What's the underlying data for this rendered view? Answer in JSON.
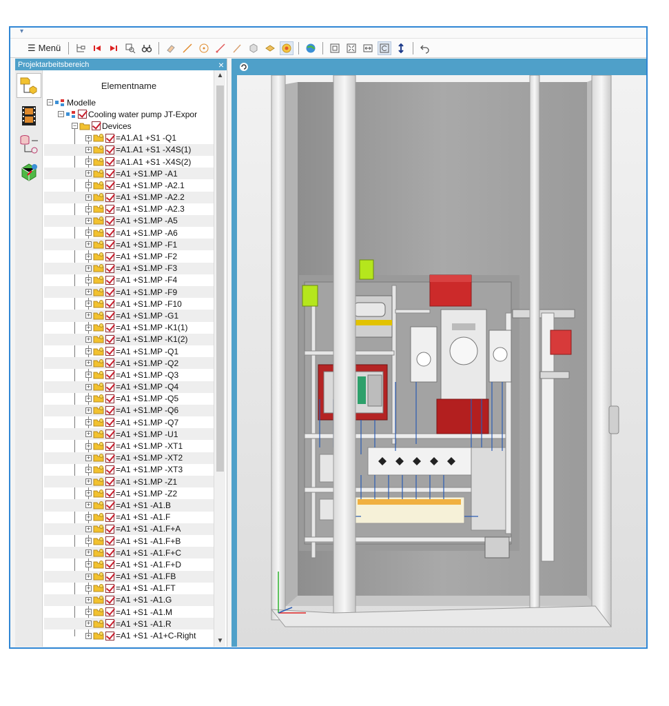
{
  "toolbar": {
    "menu_label": "Menü"
  },
  "panel": {
    "title": "Projektarbeitsbereich",
    "close_symbol": "×",
    "column_header": "Elementname",
    "scroll_up": "▲",
    "scroll_down": "▼"
  },
  "tree": {
    "root": "Modelle",
    "project": "Cooling water pump JT-Expor",
    "devices_folder": "Devices",
    "devices": [
      "=A1.A1 +S1 -Q1",
      "=A1.A1 +S1 -X4S(1)",
      "=A1.A1 +S1 -X4S(2)",
      "=A1 +S1.MP -A1",
      "=A1 +S1.MP -A2.1",
      "=A1 +S1.MP -A2.2",
      "=A1 +S1.MP -A2.3",
      "=A1 +S1.MP -A5",
      "=A1 +S1.MP -A6",
      "=A1 +S1.MP -F1",
      "=A1 +S1.MP -F2",
      "=A1 +S1.MP -F3",
      "=A1 +S1.MP -F4",
      "=A1 +S1.MP -F9",
      "=A1 +S1.MP -F10",
      "=A1 +S1.MP -G1",
      "=A1 +S1.MP -K1(1)",
      "=A1 +S1.MP -K1(2)",
      "=A1 +S1.MP -Q1",
      "=A1 +S1.MP -Q2",
      "=A1 +S1.MP -Q3",
      "=A1 +S1.MP -Q4",
      "=A1 +S1.MP -Q5",
      "=A1 +S1.MP -Q6",
      "=A1 +S1.MP -Q7",
      "=A1 +S1.MP -U1",
      "=A1 +S1.MP -XT1",
      "=A1 +S1.MP -XT2",
      "=A1 +S1.MP -XT3",
      "=A1 +S1.MP -Z1",
      "=A1 +S1.MP -Z2",
      "=A1 +S1 -A1.B",
      "=A1 +S1 -A1.F",
      "=A1 +S1 -A1.F+A",
      "=A1 +S1 -A1.F+B",
      "=A1 +S1 -A1.F+C",
      "=A1 +S1 -A1.F+D",
      "=A1 +S1 -A1.FB",
      "=A1 +S1 -A1.FT",
      "=A1 +S1 -A1.G",
      "=A1 +S1 -A1.M",
      "=A1 +S1 -A1.R",
      "=A1 +S1 -A1+C-Right"
    ]
  },
  "colors": {
    "frame_border": "#2f86d4",
    "panel_header": "#4fa0c9",
    "checkbox": "#c8202f",
    "folder": "#f2c230"
  }
}
